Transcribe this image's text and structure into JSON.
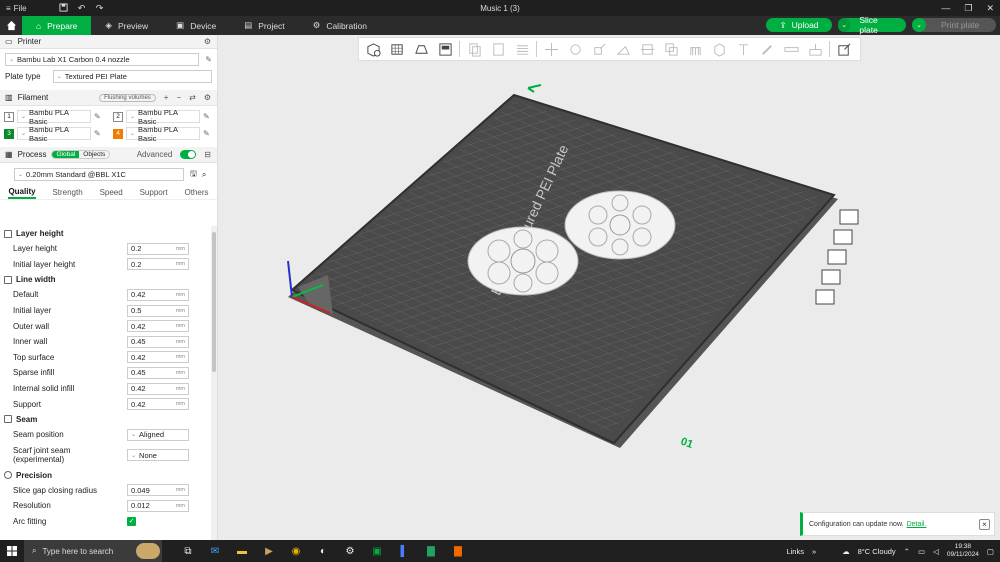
{
  "window": {
    "title": "Music 1 (3)",
    "menu_label": "File"
  },
  "nav": {
    "tabs": [
      {
        "label": "Prepare",
        "active": true
      },
      {
        "label": "Preview"
      },
      {
        "label": "Device"
      },
      {
        "label": "Project"
      },
      {
        "label": "Calibration"
      }
    ],
    "upload": "Upload",
    "slice": "Slice plate",
    "print": "Print plate"
  },
  "printer": {
    "section": "Printer",
    "name": "Bambu Lab X1 Carbon 0.4 nozzle",
    "plate_type_label": "Plate type",
    "plate_type": "Textured PEI Plate"
  },
  "filament": {
    "section": "Filament",
    "flushing": "Flushing volumes",
    "slots": [
      {
        "num": "1",
        "name": "Bambu PLA Basic",
        "color": "#ffffff"
      },
      {
        "num": "2",
        "name": "Bambu PLA Basic",
        "color": "#ffffff"
      },
      {
        "num": "3",
        "name": "Bambu PLA Basic",
        "color": "#0a8a2a"
      },
      {
        "num": "4",
        "name": "Bambu PLA Basic",
        "color": "#f07d00"
      }
    ]
  },
  "process": {
    "section": "Process",
    "global": "Global",
    "objects": "Objects",
    "advanced": "Advanced",
    "preset": "0.20mm Standard @BBL X1C",
    "tabs": [
      "Quality",
      "Strength",
      "Speed",
      "Support",
      "Others"
    ],
    "groups": [
      {
        "title": "Layer height",
        "items": [
          {
            "label": "Layer height",
            "value": "0.2",
            "unit": "mm"
          },
          {
            "label": "Initial layer height",
            "value": "0.2",
            "unit": "mm"
          }
        ]
      },
      {
        "title": "Line width",
        "items": [
          {
            "label": "Default",
            "value": "0.42",
            "unit": "mm"
          },
          {
            "label": "Initial layer",
            "value": "0.5",
            "unit": "mm"
          },
          {
            "label": "Outer wall",
            "value": "0.42",
            "unit": "mm"
          },
          {
            "label": "Inner wall",
            "value": "0.45",
            "unit": "mm"
          },
          {
            "label": "Top surface",
            "value": "0.42",
            "unit": "mm"
          },
          {
            "label": "Sparse infill",
            "value": "0.45",
            "unit": "mm"
          },
          {
            "label": "Internal solid infill",
            "value": "0.42",
            "unit": "mm"
          },
          {
            "label": "Support",
            "value": "0.42",
            "unit": "mm"
          }
        ]
      },
      {
        "title": "Seam",
        "items": [
          {
            "label": "Seam position",
            "value": "Aligned"
          },
          {
            "label": "Scarf joint seam (experimental)",
            "value": "None"
          }
        ]
      },
      {
        "title": "Precision",
        "items": [
          {
            "label": "Slice gap closing radius",
            "value": "0.049",
            "unit": "mm"
          },
          {
            "label": "Resolution",
            "value": "0.012",
            "unit": "mm"
          },
          {
            "label": "Arc fitting",
            "value": "✓"
          }
        ]
      }
    ]
  },
  "plate": {
    "label": "Bambu Textured PEI Plate",
    "number": "01",
    "accent": "#00ae42"
  },
  "notification": {
    "text": "Configuration can update now.",
    "link": "Detail."
  },
  "taskbar": {
    "search": "Type here to search",
    "links": "Links",
    "weather": "8°C Cloudy",
    "time": "19:38",
    "date": "09/11/2024"
  }
}
